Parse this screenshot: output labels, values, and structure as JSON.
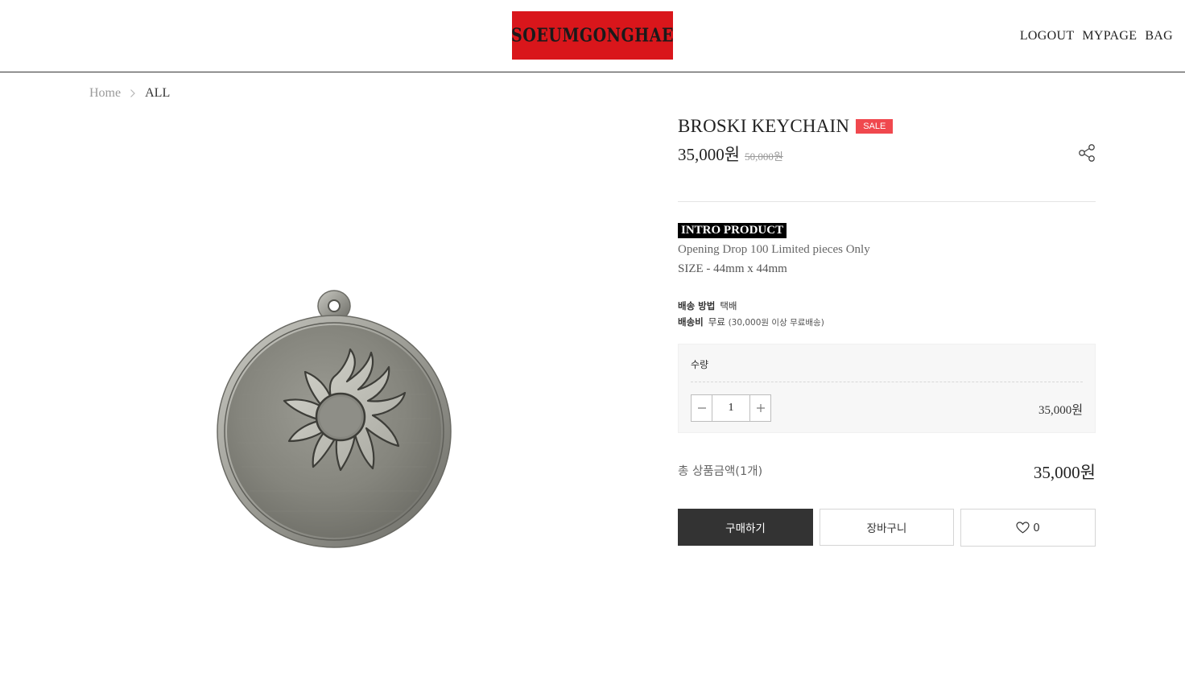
{
  "header": {
    "logo_text": "SOEUMGONGHAE",
    "logo_bg": "#d9161b",
    "nav": [
      "LOGOUT",
      "MYPAGE",
      "BAG"
    ]
  },
  "breadcrumb": {
    "home": "Home",
    "current": "ALL",
    "separator_icon": "chevron-right-icon"
  },
  "product": {
    "title": "BROSKI KEYCHAIN",
    "badge": "SALE",
    "badge_color": "#f0484e",
    "price": "35,000원",
    "original_price": "50,000원",
    "share_icon": "share-icon",
    "image": "silver round keychain medallion with sun emblem",
    "intro_tag": "INTRO PRODUCT",
    "desc_line1": "Opening Drop 100 Limited pieces Only",
    "desc_line2": "SIZE - 44mm x 44mm"
  },
  "shipping": {
    "method_label": "배송 방법",
    "method_value": "택배",
    "fee_label": "배송비",
    "fee_value": "무료",
    "fee_note": "(30,000원 이상 무료배송)"
  },
  "quantity": {
    "label": "수량",
    "value": "1",
    "line_price": "35,000원",
    "minus_icon": "minus-icon",
    "plus_icon": "plus-icon"
  },
  "total": {
    "label": "총 상품금액(1개)",
    "value": "35,000원"
  },
  "actions": {
    "buy": "구매하기",
    "cart": "장바구니",
    "like_count": "0",
    "like_icon": "heart-icon",
    "buy_bg": "#333333"
  }
}
